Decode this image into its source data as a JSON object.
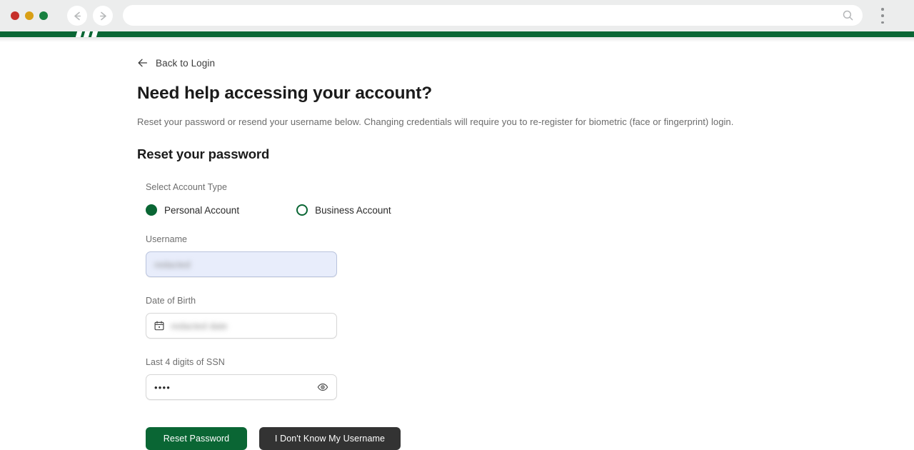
{
  "browser": {
    "traffic_lights": [
      "close",
      "minimize",
      "maximize"
    ],
    "back_icon": "arrow-left-icon",
    "forward_icon": "arrow-right-icon",
    "address_value": "",
    "address_placeholder": "",
    "address_search_icon": "search-icon",
    "menu_icon": "more-vertical-icon"
  },
  "site_header": {
    "logo": "brand-logo",
    "brand_color": "#0A6634"
  },
  "content": {
    "back_link": {
      "icon": "arrow-left-icon",
      "label": "Back to Login"
    },
    "page_title": "Need help accessing your account?",
    "description": "Reset your password or resend your username below. Changing credentials will require you to re-register for biometric (face or fingerprint) login.",
    "section_title": "Reset your password",
    "account_type": {
      "label": "Select Account Type",
      "options": [
        {
          "label": "Personal Account",
          "selected": true
        },
        {
          "label": "Business Account",
          "selected": false
        }
      ]
    },
    "fields": [
      {
        "label": "Username",
        "value": "redacted",
        "state": "autofilled",
        "redacted": true
      },
      {
        "label": "Date of Birth",
        "value": "redacted date",
        "icon": "calendar-icon",
        "redacted": true
      },
      {
        "label": "Last 4 digits of SSN",
        "value": "••••",
        "trailing_icon": "eye-icon",
        "masked": true
      }
    ],
    "buttons": {
      "primary": "Reset Password",
      "secondary": "I Don't Know My Username"
    }
  },
  "colors": {
    "brand_green": "#0A6634",
    "dark_button": "#333333",
    "autofill_background": "#E8EDFB",
    "chrome_background": "#ECEDED"
  }
}
